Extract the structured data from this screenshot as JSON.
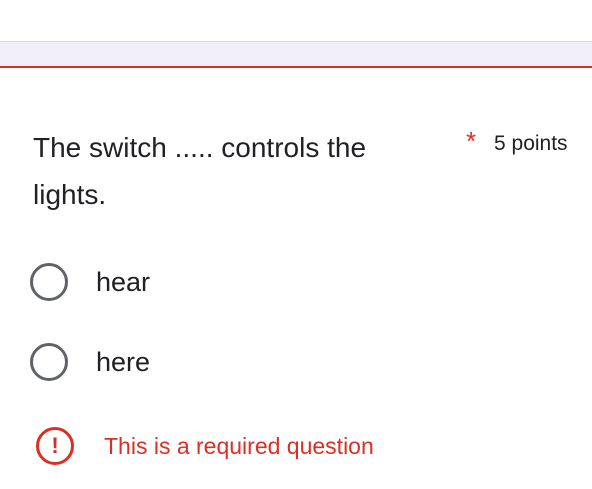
{
  "question": {
    "text": "The switch ..... controls the lights.",
    "required_marker": "*",
    "points": "5 points"
  },
  "options": [
    {
      "label": "hear",
      "selected": false
    },
    {
      "label": "here",
      "selected": false
    }
  ],
  "error": {
    "icon": "exclamation-icon",
    "message": "This is a required question"
  },
  "colors": {
    "error": "#d93025",
    "text": "#202124",
    "radio_border": "#5f6368",
    "page_background": "#f1eefa"
  }
}
